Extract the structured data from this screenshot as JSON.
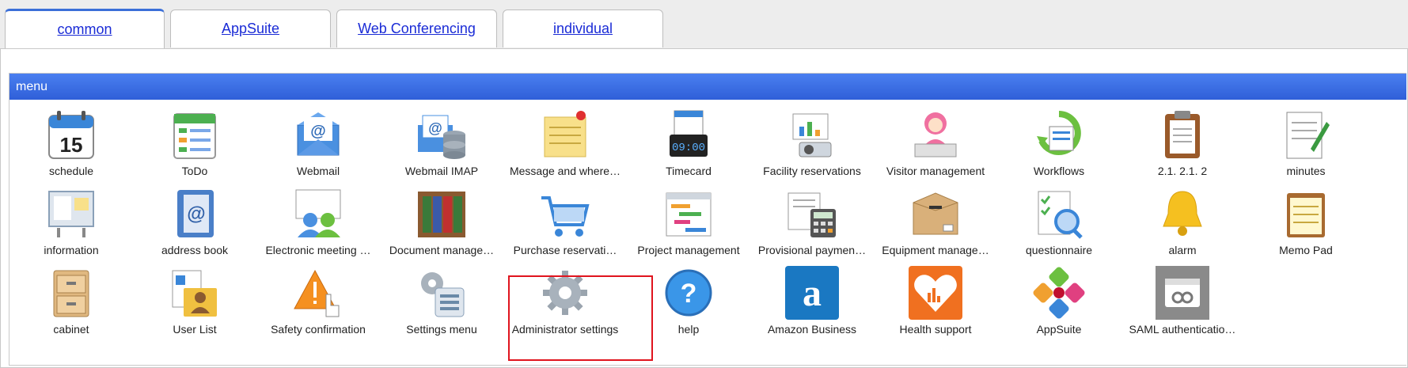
{
  "tabs": [
    {
      "label": "common",
      "active": true
    },
    {
      "label": "AppSuite",
      "active": false
    },
    {
      "label": "Web Conferencing",
      "active": false
    },
    {
      "label": "individual",
      "active": false
    }
  ],
  "menu": {
    "title": "menu",
    "items": [
      {
        "label": "schedule",
        "icon": "calendar-icon"
      },
      {
        "label": "ToDo",
        "icon": "todo-icon"
      },
      {
        "label": "Webmail",
        "icon": "mail-icon"
      },
      {
        "label": "Webmail IMAP",
        "icon": "mail-imap-icon"
      },
      {
        "label": "Message and where…",
        "icon": "sticky-note-icon"
      },
      {
        "label": "Timecard",
        "icon": "timecard-icon"
      },
      {
        "label": "Facility reservations",
        "icon": "projector-icon"
      },
      {
        "label": "Visitor management",
        "icon": "receptionist-icon"
      },
      {
        "label": "Workflows",
        "icon": "workflow-icon"
      },
      {
        "label": "2.1. 2.1. 2",
        "icon": "clipboard-icon"
      },
      {
        "label": "minutes",
        "icon": "minutes-icon"
      },
      {
        "label": "information",
        "icon": "bulletin-board-icon"
      },
      {
        "label": "address book",
        "icon": "address-book-icon"
      },
      {
        "label": "Electronic meeting …",
        "icon": "meeting-icon"
      },
      {
        "label": "Document manage…",
        "icon": "binders-icon"
      },
      {
        "label": "Purchase reservati…",
        "icon": "shopping-cart-icon"
      },
      {
        "label": "Project management",
        "icon": "gantt-icon"
      },
      {
        "label": "Provisional paymen…",
        "icon": "calculator-icon"
      },
      {
        "label": "Equipment manage…",
        "icon": "box-icon"
      },
      {
        "label": "questionnaire",
        "icon": "questionnaire-icon"
      },
      {
        "label": "alarm",
        "icon": "bell-icon"
      },
      {
        "label": "Memo Pad",
        "icon": "memo-pad-icon"
      },
      {
        "label": "cabinet",
        "icon": "cabinet-icon"
      },
      {
        "label": "User List",
        "icon": "user-list-icon"
      },
      {
        "label": "Safety confirmation",
        "icon": "safety-icon"
      },
      {
        "label": "Settings menu",
        "icon": "settings-menu-icon"
      },
      {
        "label": "Administrator settings",
        "icon": "gear-icon"
      },
      {
        "label": "help",
        "icon": "help-icon"
      },
      {
        "label": "Amazon Business",
        "icon": "amazon-icon"
      },
      {
        "label": "Health support",
        "icon": "health-icon"
      },
      {
        "label": "AppSuite",
        "icon": "appsuite-icon"
      },
      {
        "label": "SAML authenticatio…",
        "icon": "saml-icon"
      }
    ]
  },
  "colors": {
    "header": "#3366dd",
    "tab_link": "#1a2bd6",
    "highlight": "#e0141e"
  }
}
